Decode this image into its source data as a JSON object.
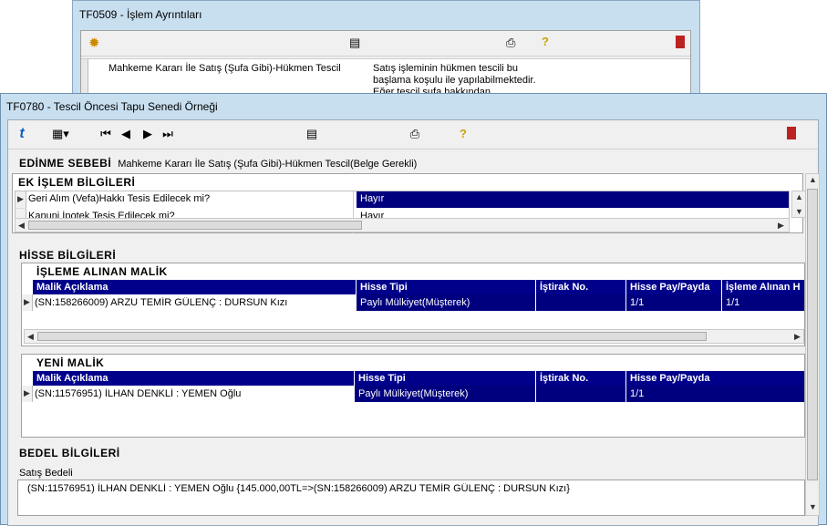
{
  "bg_window": {
    "title": "TF0509 - İşlem Ayrıntıları",
    "row_col1": "Mahkeme Kararı İle Satış (Şufa Gibi)-Hükmen Tescil",
    "row_col2_line1": "Satış işleminin hükmen tescili bu",
    "row_col2_line2": "başlama koşulu ile yapılabilmektedir.",
    "row_col2_line3": "Eğer tescil şufa hakkından"
  },
  "main_window": {
    "title": "TF0780 - Tescil Öncesi Tapu Senedi Örneği"
  },
  "edinme": {
    "label": "EDİNME SEBEBİ",
    "value": "Mahkeme Kararı İle Satış (Şufa Gibi)-Hükmen Tescil(Belge Gerekli)"
  },
  "ek_islem": {
    "title": "EK İŞLEM BİLGİLERİ",
    "rows": [
      {
        "question": "Geri Alım (Vefa)Hakkı Tesis Edilecek mi?",
        "answer": "Hayır"
      },
      {
        "question": "Kanuni İpotek Tesis Edilecek mi?",
        "answer": "Hayır"
      }
    ]
  },
  "hisse": {
    "title": "HİSSE BİLGİLERİ",
    "alinan": {
      "title": "İŞLEME ALINAN MALİK",
      "headers": [
        "Malik Açıklama",
        "Hisse Tipi",
        "İştirak No.",
        "Hisse Pay/Payda",
        "İşleme Alınan H"
      ],
      "row": [
        "(SN:158266009) ARZU TEMİR GÜLENÇ : DURSUN Kızı",
        "Paylı Mülkiyet(Müşterek)",
        "",
        "1/1",
        "1/1"
      ]
    },
    "yeni": {
      "title": "YENİ MALİK",
      "headers": [
        "Malik Açıklama",
        "Hisse Tipi",
        "İştirak No.",
        "Hisse Pay/Payda"
      ],
      "row": [
        "(SN:11576951) İLHAN DENKLİ : YEMEN Oğlu",
        "Paylı Mülkiyet(Müşterek)",
        "",
        "1/1"
      ]
    }
  },
  "bedel": {
    "title": "BEDEL BİLGİLERİ",
    "label": "Satış Bedeli",
    "value": "(SN:11576951) İLHAN DENKLİ : YEMEN Oğlu {145.000,00TL=>(SN:158266009) ARZU TEMİR GÜLENÇ : DURSUN Kızı}"
  },
  "colors": {
    "selection": "#00007f",
    "header": "#00008b",
    "window": "#c8dff0"
  }
}
